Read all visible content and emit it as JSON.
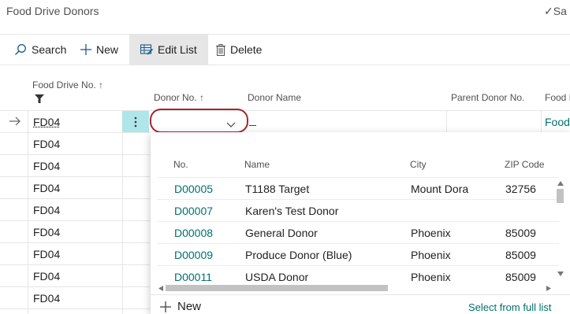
{
  "page": {
    "title": "Food Drive Donors",
    "saved_label": "Sa"
  },
  "toolbar": {
    "search": "Search",
    "new": "New",
    "edit_list": "Edit List",
    "delete": "Delete"
  },
  "columns": {
    "food_drive_no": "Food Drive No. ↑",
    "donor_no": "Donor No. ↑",
    "donor_name": "Donor Name",
    "parent_donor_no": "Parent Donor No.",
    "food": "Food I"
  },
  "rows": [
    "FD04",
    "FD04",
    "FD04",
    "FD04",
    "FD04",
    "FD04",
    "FD04",
    "FD04",
    "FD04"
  ],
  "active_row": {
    "food_link": "Food"
  },
  "lookup": {
    "headers": {
      "no": "No.",
      "name": "Name",
      "city": "City",
      "zip": "ZIP Code"
    },
    "items": [
      {
        "no": "D00005",
        "name": "T1188 Target",
        "city": "Mount Dora",
        "zip": "32756"
      },
      {
        "no": "D00007",
        "name": "Karen's Test Donor",
        "city": "",
        "zip": ""
      },
      {
        "no": "D00008",
        "name": "General Donor",
        "city": "Phoenix",
        "zip": "85009"
      },
      {
        "no": "D00009",
        "name": "Produce Donor (Blue)",
        "city": "Phoenix",
        "zip": "85009"
      },
      {
        "no": "D00011",
        "name": "USDA Donor",
        "city": "Phoenix",
        "zip": "85009"
      }
    ],
    "new_label": "New",
    "full_list_label": "Select from full list"
  },
  "colors": {
    "accent": "#00706e",
    "highlight": "#aee6ea",
    "focus_ring": "#a4262c"
  }
}
